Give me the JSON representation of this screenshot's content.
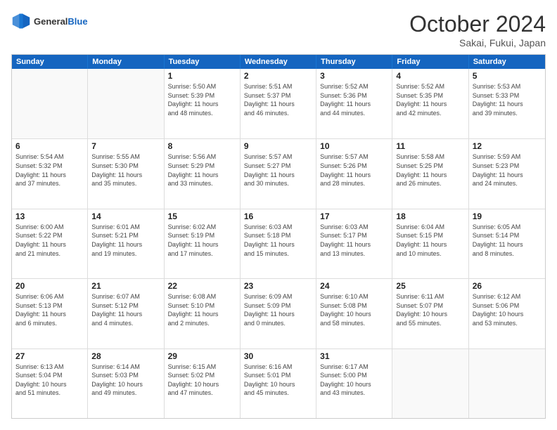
{
  "logo": {
    "line1": "General",
    "line2": "Blue"
  },
  "title": "October 2024",
  "subtitle": "Sakai, Fukui, Japan",
  "header_days": [
    "Sunday",
    "Monday",
    "Tuesday",
    "Wednesday",
    "Thursday",
    "Friday",
    "Saturday"
  ],
  "weeks": [
    [
      {
        "day": "",
        "info": ""
      },
      {
        "day": "",
        "info": ""
      },
      {
        "day": "1",
        "info": "Sunrise: 5:50 AM\nSunset: 5:39 PM\nDaylight: 11 hours\nand 48 minutes."
      },
      {
        "day": "2",
        "info": "Sunrise: 5:51 AM\nSunset: 5:37 PM\nDaylight: 11 hours\nand 46 minutes."
      },
      {
        "day": "3",
        "info": "Sunrise: 5:52 AM\nSunset: 5:36 PM\nDaylight: 11 hours\nand 44 minutes."
      },
      {
        "day": "4",
        "info": "Sunrise: 5:52 AM\nSunset: 5:35 PM\nDaylight: 11 hours\nand 42 minutes."
      },
      {
        "day": "5",
        "info": "Sunrise: 5:53 AM\nSunset: 5:33 PM\nDaylight: 11 hours\nand 39 minutes."
      }
    ],
    [
      {
        "day": "6",
        "info": "Sunrise: 5:54 AM\nSunset: 5:32 PM\nDaylight: 11 hours\nand 37 minutes."
      },
      {
        "day": "7",
        "info": "Sunrise: 5:55 AM\nSunset: 5:30 PM\nDaylight: 11 hours\nand 35 minutes."
      },
      {
        "day": "8",
        "info": "Sunrise: 5:56 AM\nSunset: 5:29 PM\nDaylight: 11 hours\nand 33 minutes."
      },
      {
        "day": "9",
        "info": "Sunrise: 5:57 AM\nSunset: 5:27 PM\nDaylight: 11 hours\nand 30 minutes."
      },
      {
        "day": "10",
        "info": "Sunrise: 5:57 AM\nSunset: 5:26 PM\nDaylight: 11 hours\nand 28 minutes."
      },
      {
        "day": "11",
        "info": "Sunrise: 5:58 AM\nSunset: 5:25 PM\nDaylight: 11 hours\nand 26 minutes."
      },
      {
        "day": "12",
        "info": "Sunrise: 5:59 AM\nSunset: 5:23 PM\nDaylight: 11 hours\nand 24 minutes."
      }
    ],
    [
      {
        "day": "13",
        "info": "Sunrise: 6:00 AM\nSunset: 5:22 PM\nDaylight: 11 hours\nand 21 minutes."
      },
      {
        "day": "14",
        "info": "Sunrise: 6:01 AM\nSunset: 5:21 PM\nDaylight: 11 hours\nand 19 minutes."
      },
      {
        "day": "15",
        "info": "Sunrise: 6:02 AM\nSunset: 5:19 PM\nDaylight: 11 hours\nand 17 minutes."
      },
      {
        "day": "16",
        "info": "Sunrise: 6:03 AM\nSunset: 5:18 PM\nDaylight: 11 hours\nand 15 minutes."
      },
      {
        "day": "17",
        "info": "Sunrise: 6:03 AM\nSunset: 5:17 PM\nDaylight: 11 hours\nand 13 minutes."
      },
      {
        "day": "18",
        "info": "Sunrise: 6:04 AM\nSunset: 5:15 PM\nDaylight: 11 hours\nand 10 minutes."
      },
      {
        "day": "19",
        "info": "Sunrise: 6:05 AM\nSunset: 5:14 PM\nDaylight: 11 hours\nand 8 minutes."
      }
    ],
    [
      {
        "day": "20",
        "info": "Sunrise: 6:06 AM\nSunset: 5:13 PM\nDaylight: 11 hours\nand 6 minutes."
      },
      {
        "day": "21",
        "info": "Sunrise: 6:07 AM\nSunset: 5:12 PM\nDaylight: 11 hours\nand 4 minutes."
      },
      {
        "day": "22",
        "info": "Sunrise: 6:08 AM\nSunset: 5:10 PM\nDaylight: 11 hours\nand 2 minutes."
      },
      {
        "day": "23",
        "info": "Sunrise: 6:09 AM\nSunset: 5:09 PM\nDaylight: 11 hours\nand 0 minutes."
      },
      {
        "day": "24",
        "info": "Sunrise: 6:10 AM\nSunset: 5:08 PM\nDaylight: 10 hours\nand 58 minutes."
      },
      {
        "day": "25",
        "info": "Sunrise: 6:11 AM\nSunset: 5:07 PM\nDaylight: 10 hours\nand 55 minutes."
      },
      {
        "day": "26",
        "info": "Sunrise: 6:12 AM\nSunset: 5:06 PM\nDaylight: 10 hours\nand 53 minutes."
      }
    ],
    [
      {
        "day": "27",
        "info": "Sunrise: 6:13 AM\nSunset: 5:04 PM\nDaylight: 10 hours\nand 51 minutes."
      },
      {
        "day": "28",
        "info": "Sunrise: 6:14 AM\nSunset: 5:03 PM\nDaylight: 10 hours\nand 49 minutes."
      },
      {
        "day": "29",
        "info": "Sunrise: 6:15 AM\nSunset: 5:02 PM\nDaylight: 10 hours\nand 47 minutes."
      },
      {
        "day": "30",
        "info": "Sunrise: 6:16 AM\nSunset: 5:01 PM\nDaylight: 10 hours\nand 45 minutes."
      },
      {
        "day": "31",
        "info": "Sunrise: 6:17 AM\nSunset: 5:00 PM\nDaylight: 10 hours\nand 43 minutes."
      },
      {
        "day": "",
        "info": ""
      },
      {
        "day": "",
        "info": ""
      }
    ]
  ]
}
